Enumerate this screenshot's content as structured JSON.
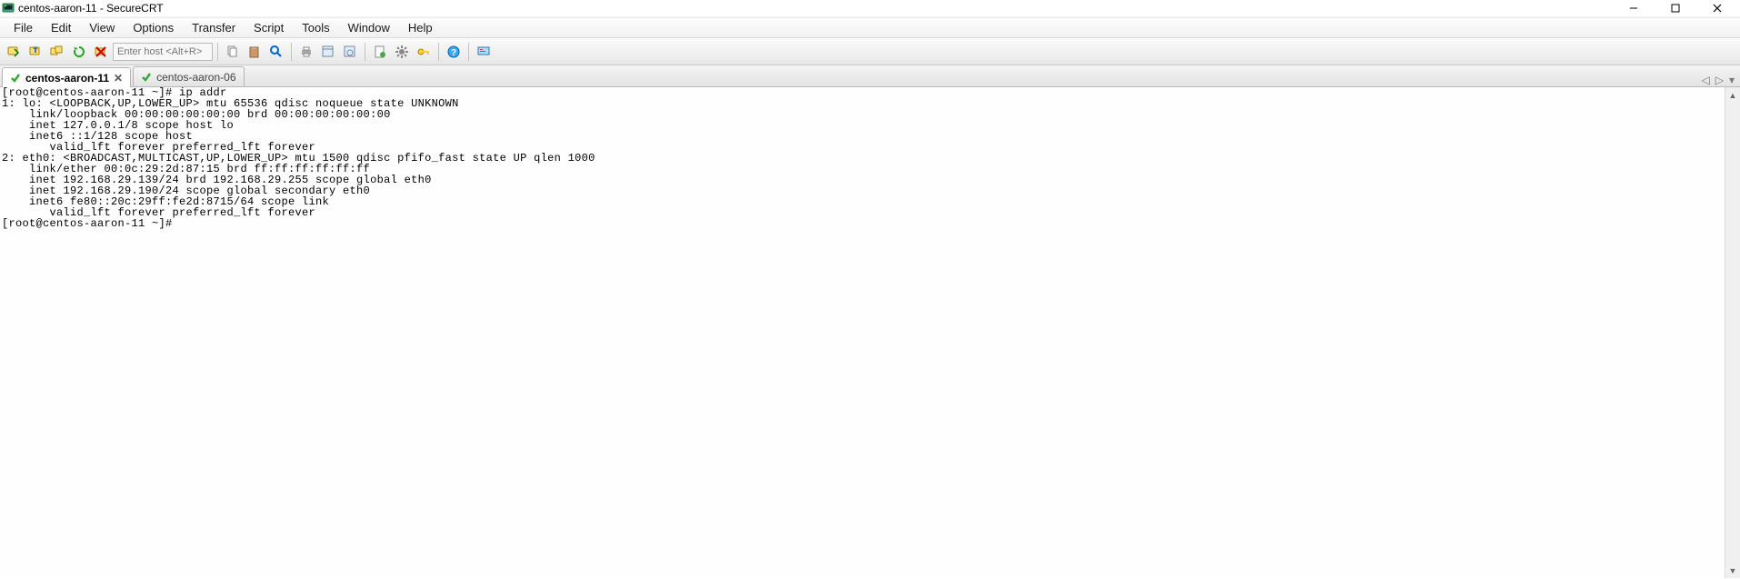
{
  "window": {
    "title": "centos-aaron-11 - SecureCRT"
  },
  "menu": {
    "file": "File",
    "edit": "Edit",
    "view": "View",
    "options": "Options",
    "transfer": "Transfer",
    "script": "Script",
    "tools": "Tools",
    "window": "Window",
    "help": "Help"
  },
  "toolbar": {
    "host_placeholder": "Enter host <Alt+R>"
  },
  "tabs": {
    "active": "centos-aaron-11",
    "inactive": "centos-aaron-06"
  },
  "terminal": {
    "lines": [
      "[root@centos-aaron-11 ~]# ip addr",
      "1: lo: <LOOPBACK,UP,LOWER_UP> mtu 65536 qdisc noqueue state UNKNOWN",
      "    link/loopback 00:00:00:00:00:00 brd 00:00:00:00:00:00",
      "    inet 127.0.0.1/8 scope host lo",
      "    inet6 ::1/128 scope host",
      "       valid_lft forever preferred_lft forever",
      "2: eth0: <BROADCAST,MULTICAST,UP,LOWER_UP> mtu 1500 qdisc pfifo_fast state UP qlen 1000",
      "    link/ether 00:0c:29:2d:87:15 brd ff:ff:ff:ff:ff:ff",
      "    inet 192.168.29.139/24 brd 192.168.29.255 scope global eth0",
      "    inet 192.168.29.190/24 scope global secondary eth0",
      "    inet6 fe80::20c:29ff:fe2d:8715/64 scope link",
      "       valid_lft forever preferred_lft forever",
      "[root@centos-aaron-11 ~]#"
    ]
  }
}
